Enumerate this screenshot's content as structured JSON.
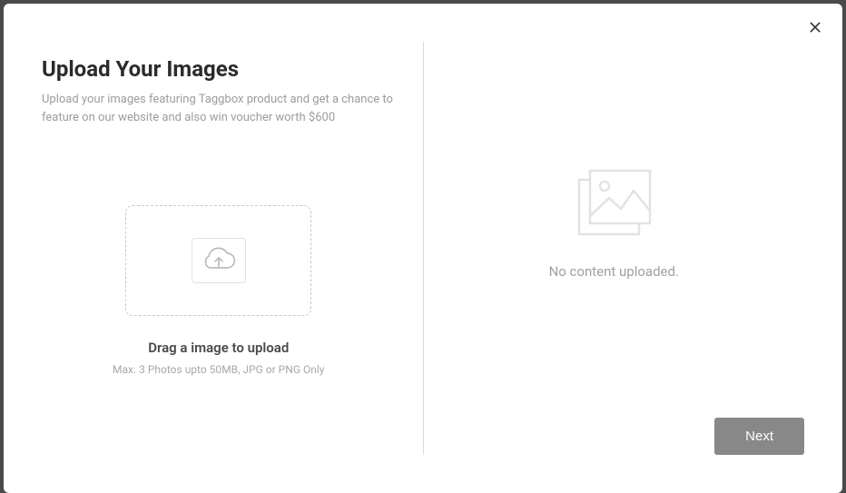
{
  "header": {
    "title": "Upload Your Images",
    "subtitle": "Upload your images featuring Taggbox product and get a chance to feature on our website and also win voucher worth $600"
  },
  "dropzone": {
    "title": "Drag a image to upload",
    "hint": "Max. 3 Photos upto 50MB, JPG or PNG Only"
  },
  "empty": {
    "message": "No content uploaded."
  },
  "actions": {
    "next_label": "Next"
  }
}
